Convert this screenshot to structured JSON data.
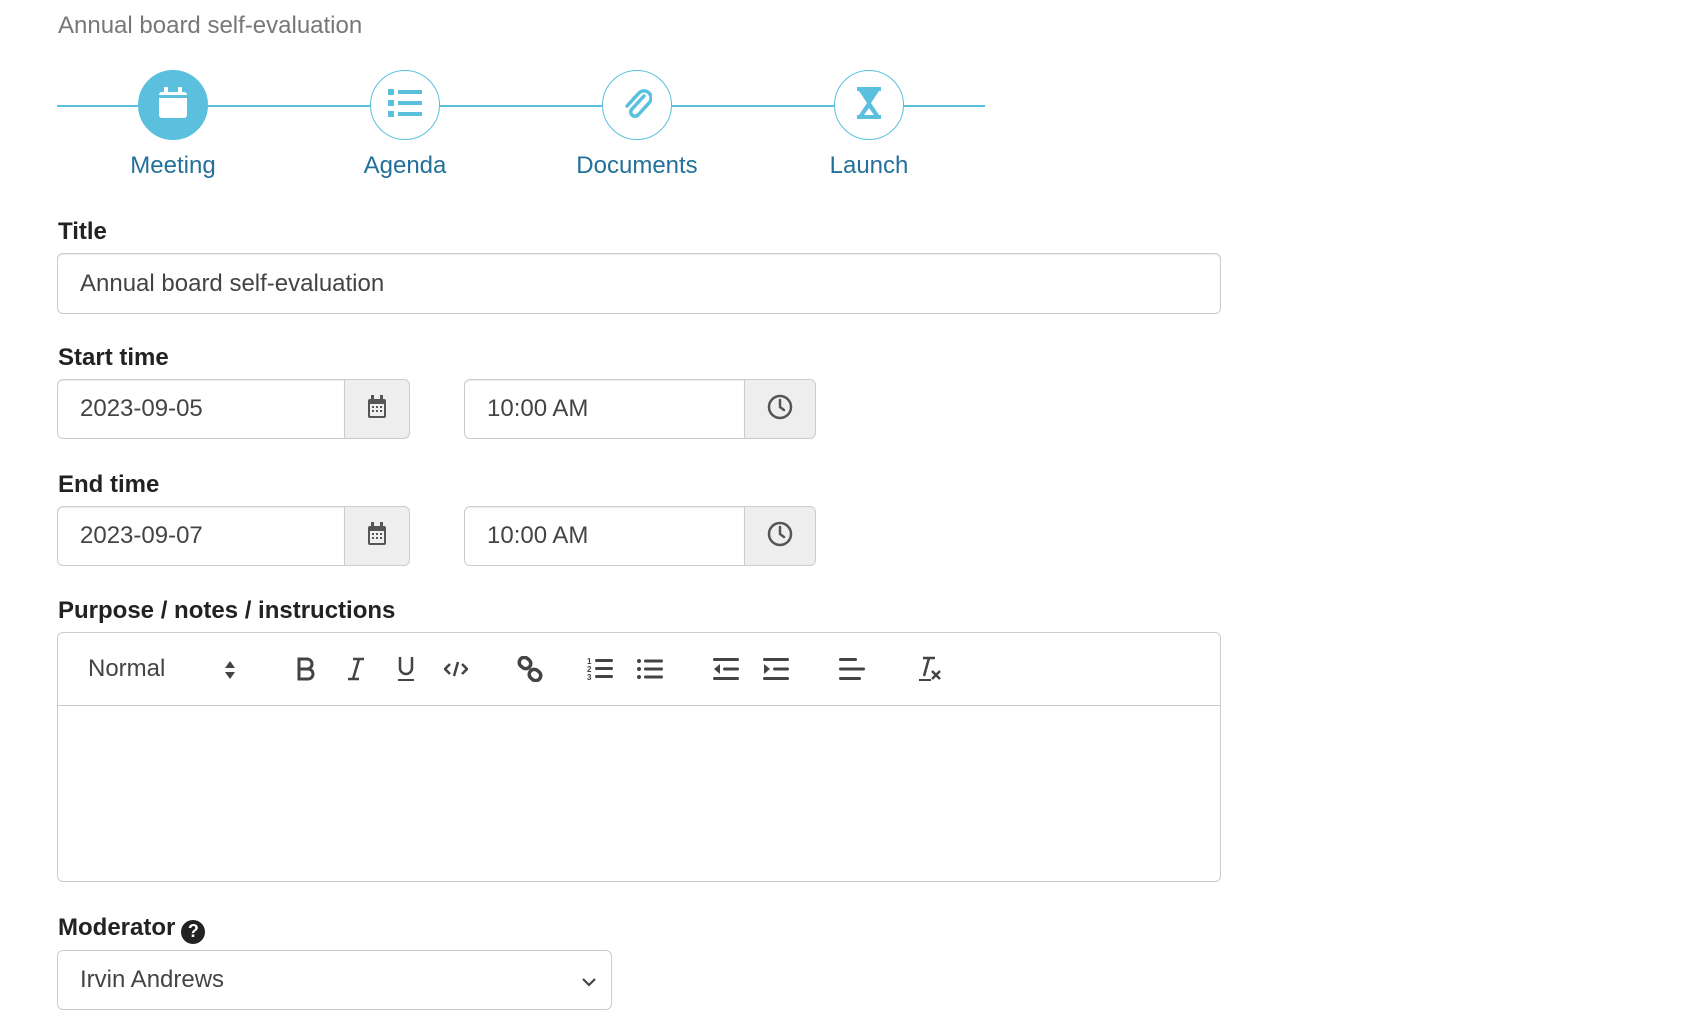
{
  "page": {
    "subtitle": "Annual board self-evaluation"
  },
  "stepper": {
    "accent_color": "#5bc0de",
    "label_color": "#23709a",
    "active_index": 0,
    "steps": [
      {
        "label": "Meeting",
        "icon": "calendar-icon"
      },
      {
        "label": "Agenda",
        "icon": "list-icon"
      },
      {
        "label": "Documents",
        "icon": "paperclip-icon"
      },
      {
        "label": "Launch",
        "icon": "hourglass-icon"
      }
    ]
  },
  "form": {
    "title": {
      "label": "Title",
      "value": "Annual board self-evaluation"
    },
    "start_time": {
      "label": "Start time",
      "date": "2023-09-05",
      "time": "10:00 AM"
    },
    "end_time": {
      "label": "End time",
      "date": "2023-09-07",
      "time": "10:00 AM"
    },
    "notes": {
      "label": "Purpose / notes / instructions",
      "format": "Normal",
      "toolbar": [
        "bold",
        "italic",
        "underline",
        "code",
        "link",
        "ordered-list",
        "bullet-list",
        "outdent",
        "indent",
        "align",
        "clear-formatting"
      ],
      "value": ""
    },
    "moderator": {
      "label": "Moderator",
      "help_icon": "question-circle-icon",
      "value": "Irvin Andrews"
    }
  }
}
